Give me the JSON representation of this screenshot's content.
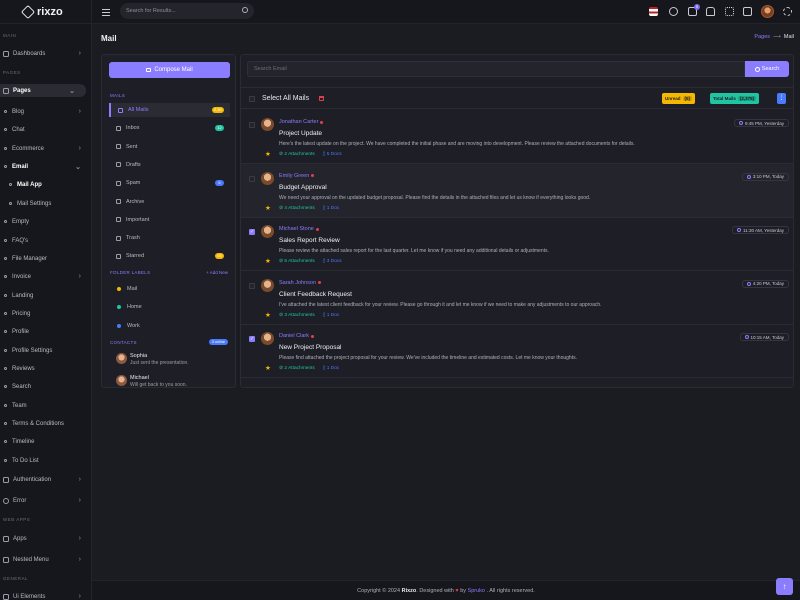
{
  "brand": {
    "name": "rixzo"
  },
  "header": {
    "search_placeholder": "Search for Results...",
    "cart_count": "5"
  },
  "sidebar": {
    "sections": [
      "MAIN",
      "PAGES",
      "WEB APPS",
      "GENERAL"
    ],
    "items": [
      {
        "label": "Dashboards"
      },
      {
        "label": "Pages"
      },
      {
        "label": "Blog"
      },
      {
        "label": "Chat"
      },
      {
        "label": "Ecommerce"
      },
      {
        "label": "Email"
      },
      {
        "label": "Mail App"
      },
      {
        "label": "Mail Settings"
      },
      {
        "label": "Empty"
      },
      {
        "label": "FAQ's"
      },
      {
        "label": "File Manager"
      },
      {
        "label": "Invoice"
      },
      {
        "label": "Landing"
      },
      {
        "label": "Pricing"
      },
      {
        "label": "Profile"
      },
      {
        "label": "Profile Settings"
      },
      {
        "label": "Reviews"
      },
      {
        "label": "Search"
      },
      {
        "label": "Team"
      },
      {
        "label": "Terms & Conditions"
      },
      {
        "label": "Timeline"
      },
      {
        "label": "To Do List"
      },
      {
        "label": "Authentication"
      },
      {
        "label": "Error"
      },
      {
        "label": "Apps"
      },
      {
        "label": "Nested Menu"
      },
      {
        "label": "Ui Elements"
      }
    ]
  },
  "page": {
    "title": "Mail",
    "breadcrumb_link": "Pages",
    "breadcrumb_sep": "⟶",
    "breadcrumb_current": "Mail"
  },
  "mailnav": {
    "compose_label": "Compose Mail",
    "mails_section": "MAILS",
    "folders": [
      {
        "label": "All Mails",
        "count": "2,3K",
        "count_color": "#f5b800"
      },
      {
        "label": "Inbox",
        "count": "12",
        "count_color": "#20c4a0"
      },
      {
        "label": "Sent",
        "count": "",
        "count_color": ""
      },
      {
        "label": "Drafts",
        "count": "",
        "count_color": ""
      },
      {
        "label": "Spam",
        "count": "6",
        "count_color": "#4a7bff"
      },
      {
        "label": "Archive",
        "count": "",
        "count_color": ""
      },
      {
        "label": "Important",
        "count": "",
        "count_color": ""
      },
      {
        "label": "Trash",
        "count": "",
        "count_color": ""
      },
      {
        "label": "Starred",
        "count": "05",
        "count_color": "#f5b800"
      }
    ],
    "labels_section": "FOLDER LABELS",
    "add_new": "+ Add New",
    "labels": [
      {
        "label": "Mail",
        "color": "#f5b800"
      },
      {
        "label": "Home",
        "color": "#20c4a0"
      },
      {
        "label": "Work",
        "color": "#4a7bff"
      }
    ],
    "contacts_section": "CONTACTS",
    "online_badge": "3 online",
    "contacts": [
      {
        "name": "Sophia",
        "message": "Just sent the presentation."
      },
      {
        "name": "Michael",
        "message": "Will get back to you soon."
      }
    ]
  },
  "maillist": {
    "search_placeholder": "Search Email",
    "search_button": "Search",
    "select_all": "Select All Mails",
    "unread_label": "Unread",
    "unread_count": "(5)",
    "total_label": "Total Mails",
    "total_count": "(2,375)",
    "more_label": "⋮",
    "mails": [
      {
        "sender": "Jonathan Carter",
        "subject": "Project Update",
        "body": "Here's the latest update on the project. We have completed the initial phase and are moving into development. Please review the attached documents for details.",
        "attachments": "2 Attachments",
        "docs": "5 Docs",
        "time": "9:45 PM, Yesterday",
        "checked": false,
        "highlight": false
      },
      {
        "sender": "Emily Green",
        "subject": "Budget Approval",
        "body": "We need your approval on the updated budget proposal. Please find the details in the attached files and let us know if everything looks good.",
        "attachments": "4 Attachments",
        "docs": "1 Doc",
        "time": "3:10 PM, Today",
        "checked": false,
        "highlight": true
      },
      {
        "sender": "Michael Stone",
        "subject": "Sales Report Review",
        "body": "Please review the attached sales report for the last quarter. Let me know if you need any additional details or adjustments.",
        "attachments": "5 Attachments",
        "docs": "3 Docs",
        "time": "11:30 AM, Yesterday",
        "checked": true,
        "highlight": false
      },
      {
        "sender": "Sarah Johnson",
        "subject": "Client Feedback Request",
        "body": "I've attached the latest client feedback for your review. Please go through it and let me know if we need to make any adjustments to our approach.",
        "attachments": "3 Attachments",
        "docs": "1 Doc",
        "time": "4:20 PM, Today",
        "checked": false,
        "highlight": false
      },
      {
        "sender": "Daniel Clark",
        "subject": "New Project Proposal",
        "body": "Please find attached the project proposal for your review. We've included the timeline and estimated costs. Let me know your thoughts.",
        "attachments": "2 Attachments",
        "docs": "1 Doc",
        "time": "10:15 AM, Today",
        "checked": true,
        "highlight": false
      }
    ]
  },
  "footer": {
    "prefix": "Copyright © 2024",
    "brand": "Rixzo",
    "mid": ". Designed with",
    "by": "by",
    "author": "Spruko",
    "suffix": ". All rights reserved."
  },
  "colors": {
    "accent": "#8b7dff",
    "unread": "#f5b800",
    "total": "#20c4a0",
    "danger": "#e0404a"
  }
}
